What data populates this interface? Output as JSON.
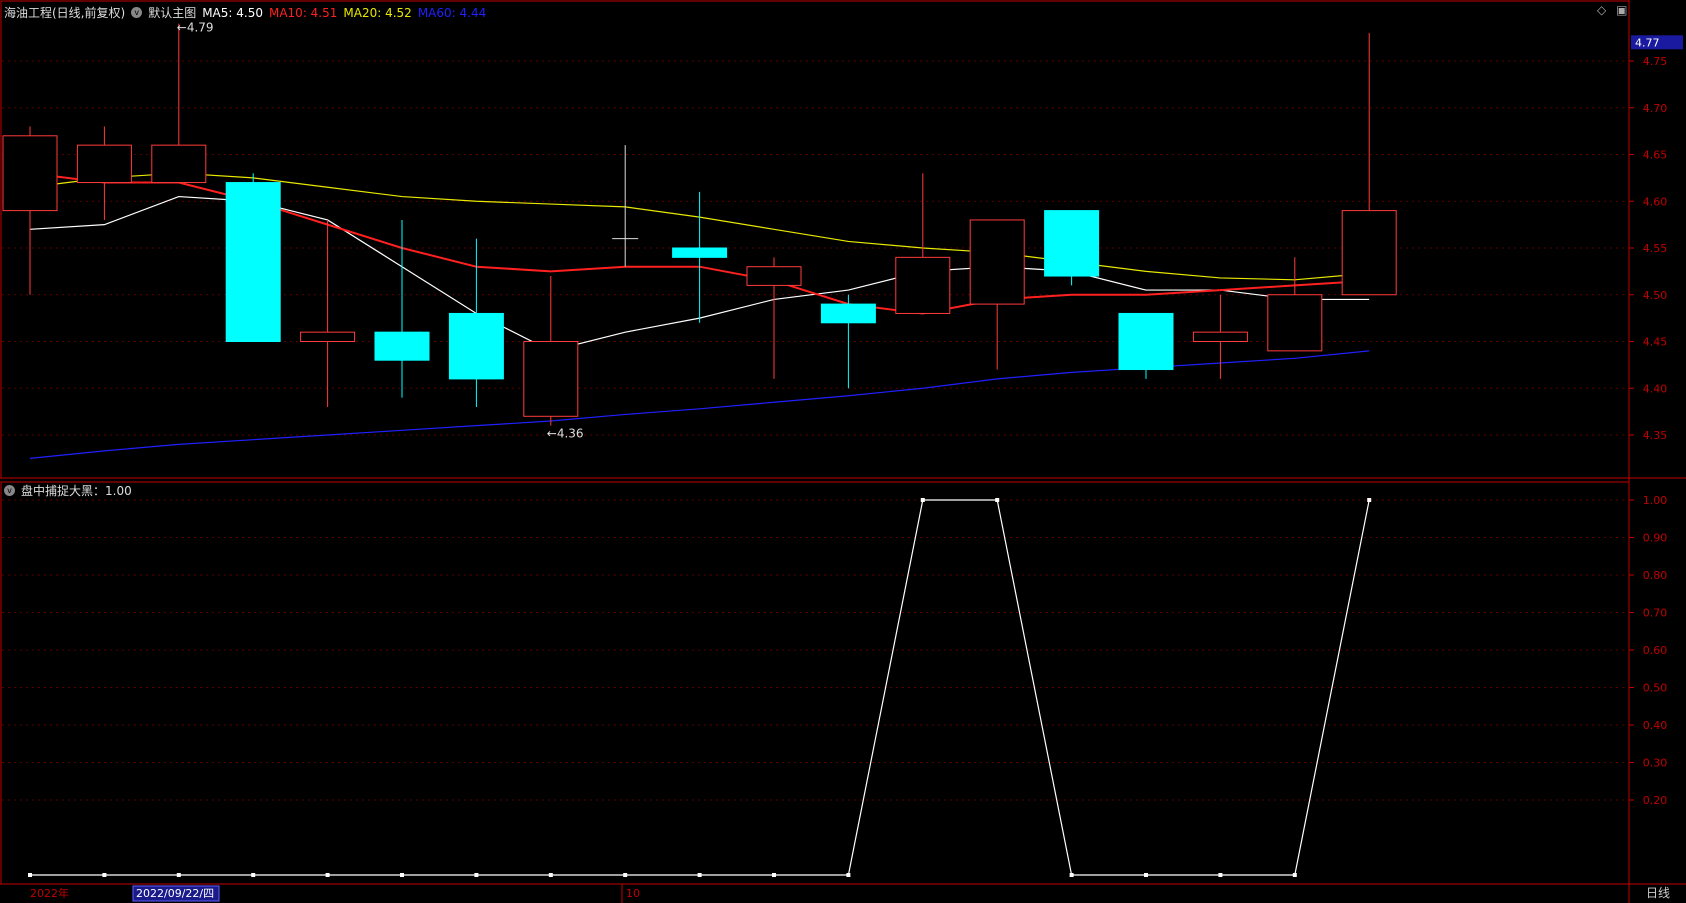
{
  "header": {
    "stock_title": "海油工程(日线,前复权)",
    "main_chart_label": "默认主图",
    "ma5_label": "MA5: 4.50",
    "ma10_label": "MA10: 4.51",
    "ma20_label": "MA20: 4.52",
    "ma60_label": "MA60: 4.44"
  },
  "indicator": {
    "label": "盘中捕捉大黑：1.00"
  },
  "x_axis": {
    "year_label": "2022年",
    "cursor_date": "2022/09/22/四",
    "month_label": "10",
    "period_label": "日线"
  },
  "price_annotations": {
    "high": "4.79",
    "low": "4.36"
  },
  "last_price_tag": "4.77",
  "colors": {
    "up": "#ff3b3b",
    "down": "#00ffff",
    "ma5": "#ffffff",
    "ma10": "#ff2020",
    "ma20": "#e8e800",
    "ma60": "#2020ff",
    "axis_red": "#c00000"
  },
  "chart_data": [
    {
      "type": "candlestick",
      "title": "海油工程(日线,前复权)",
      "ylim": [
        4.31,
        4.81
      ],
      "yticks": [
        4.35,
        4.4,
        4.45,
        4.5,
        4.55,
        4.6,
        4.65,
        4.7,
        4.75
      ],
      "candles": [
        {
          "o": 4.59,
          "c": 4.67,
          "h": 4.68,
          "l": 4.5
        },
        {
          "o": 4.62,
          "c": 4.66,
          "h": 4.68,
          "l": 4.58
        },
        {
          "o": 4.62,
          "c": 4.66,
          "h": 4.79,
          "l": 4.62
        },
        {
          "o": 4.62,
          "c": 4.45,
          "h": 4.63,
          "l": 4.45
        },
        {
          "o": 4.45,
          "c": 4.46,
          "h": 4.58,
          "l": 4.38
        },
        {
          "o": 4.46,
          "c": 4.43,
          "h": 4.58,
          "l": 4.39
        },
        {
          "o": 4.48,
          "c": 4.41,
          "h": 4.56,
          "l": 4.38
        },
        {
          "o": 4.37,
          "c": 4.45,
          "h": 4.52,
          "l": 4.36
        },
        {
          "o": 4.56,
          "c": 4.56,
          "h": 4.66,
          "l": 4.53
        },
        {
          "o": 4.55,
          "c": 4.54,
          "h": 4.61,
          "l": 4.47
        },
        {
          "o": 4.51,
          "c": 4.53,
          "h": 4.54,
          "l": 4.41
        },
        {
          "o": 4.49,
          "c": 4.47,
          "h": 4.5,
          "l": 4.4
        },
        {
          "o": 4.48,
          "c": 4.54,
          "h": 4.63,
          "l": 4.48
        },
        {
          "o": 4.49,
          "c": 4.58,
          "h": 4.58,
          "l": 4.42
        },
        {
          "o": 4.59,
          "c": 4.52,
          "h": 4.59,
          "l": 4.51
        },
        {
          "o": 4.48,
          "c": 4.42,
          "h": 4.48,
          "l": 4.41
        },
        {
          "o": 4.45,
          "c": 4.46,
          "h": 4.5,
          "l": 4.41
        },
        {
          "o": 4.44,
          "c": 4.5,
          "h": 4.54,
          "l": 4.44
        },
        {
          "o": 4.5,
          "c": 4.59,
          "h": 4.78,
          "l": 4.5
        }
      ],
      "series": [
        {
          "name": "MA5",
          "values": [
            4.57,
            4.575,
            4.605,
            4.6,
            4.58,
            4.53,
            4.48,
            4.44,
            4.46,
            4.475,
            4.495,
            4.505,
            4.525,
            4.53,
            4.525,
            4.505,
            4.505,
            4.495,
            4.495
          ]
        },
        {
          "name": "MA10",
          "values": [
            4.63,
            4.62,
            4.62,
            4.6,
            4.575,
            4.55,
            4.53,
            4.525,
            4.53,
            4.53,
            4.515,
            4.49,
            4.48,
            4.495,
            4.5,
            4.5,
            4.505,
            4.51,
            4.515
          ]
        },
        {
          "name": "MA20",
          "values": [
            4.615,
            4.625,
            4.63,
            4.625,
            4.615,
            4.605,
            4.6,
            4.597,
            4.594,
            4.583,
            4.57,
            4.557,
            4.55,
            4.545,
            4.535,
            4.525,
            4.518,
            4.516,
            4.523
          ]
        },
        {
          "name": "MA60",
          "values": [
            4.325,
            4.333,
            4.34,
            4.345,
            4.35,
            4.355,
            4.36,
            4.365,
            4.372,
            4.378,
            4.385,
            4.392,
            4.4,
            4.41,
            4.417,
            4.422,
            4.427,
            4.432,
            4.44
          ]
        }
      ]
    },
    {
      "type": "line",
      "title": "盘中捕捉大黑：1.00",
      "ylim": [
        0,
        1.05
      ],
      "yticks": [
        0.2,
        0.3,
        0.4,
        0.5,
        0.6,
        0.7,
        0.8,
        0.9,
        1.0
      ],
      "values": [
        0,
        0,
        0,
        0,
        0,
        0,
        0,
        0,
        0,
        0,
        0,
        0,
        1,
        1,
        0,
        0,
        0,
        0,
        1
      ]
    }
  ]
}
